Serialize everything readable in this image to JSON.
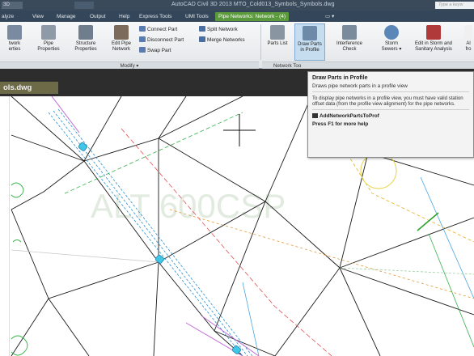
{
  "titlebar": {
    "quick_access": "ЗD",
    "title": "AutoCAD Civil 3D 2013   MTO_Cold013_Symbols_Symbols.dwg",
    "search_placeholder": "Type a keyw"
  },
  "tabs": [
    {
      "label": "alyze"
    },
    {
      "label": "View"
    },
    {
      "label": "Manage"
    },
    {
      "label": "Output"
    },
    {
      "label": "Help"
    },
    {
      "label": "Express Tools"
    },
    {
      "label": "UMI Tools"
    },
    {
      "label": "Pipe Networks: Network - (4)"
    }
  ],
  "tabs_extra": "▭ ▾",
  "ribbon": {
    "buttons": [
      {
        "label": "twork\nerties"
      },
      {
        "label": "Pipe\nProperties"
      },
      {
        "label": "Structure\nProperties"
      },
      {
        "label": "Edit Pipe\nNetwork"
      }
    ],
    "small_buttons": [
      {
        "label": "Connect Part"
      },
      {
        "label": "Disconnect Part"
      },
      {
        "label": "Swap Part"
      },
      {
        "label": "Split Network"
      },
      {
        "label": "Merge Networks"
      }
    ],
    "modify_panel": "Modify ▾",
    "network_tools": [
      {
        "label": "Parts List"
      },
      {
        "label": "Draw Parts\nin Profile"
      },
      {
        "label": "Interference\nCheck"
      },
      {
        "label": "Storm\nSewers ▾"
      },
      {
        "label": "Edit in Storm and\nSanitary Analysis"
      },
      {
        "label": "Al\nfro"
      }
    ],
    "network_panel": "Network Too"
  },
  "document": {
    "tab_label": "ols.dwg"
  },
  "canvas": {
    "watermark": "ALT 600CSP"
  },
  "tooltip": {
    "title": "Draw Parts in Profile",
    "subtitle": "Draws pipe network parts in a profile view",
    "body": "To display pipe networks in a profile view, you must have valid station offset data (from the profile view alignment) for the pipe networks.",
    "command": "AddNetworkPartsToProf",
    "help": "Press F1 for more help"
  },
  "colors": {
    "active_tab": "#5a9a3a",
    "doc_tab": "#6d6a47",
    "pipe_cyan": "#2a8fd0",
    "survey_line": "#1a1a1a"
  }
}
